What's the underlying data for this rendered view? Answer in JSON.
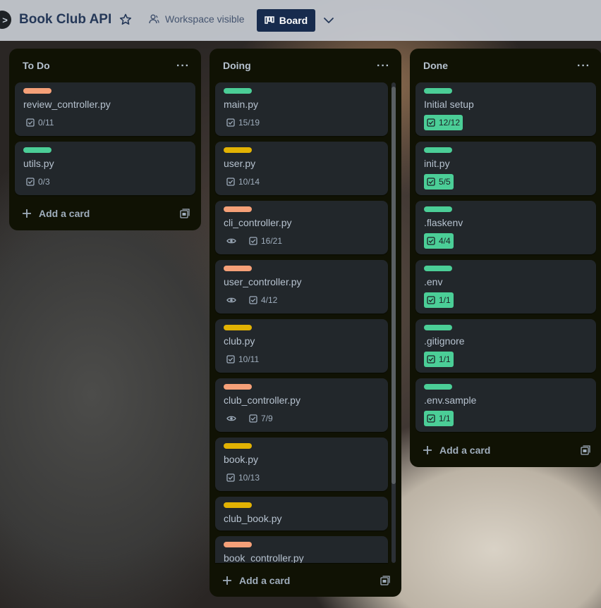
{
  "header": {
    "title": "Book Club API",
    "visibility_label": "Workspace visible",
    "board_button_label": "Board",
    "sidebar_toggle_glyph": ">"
  },
  "colors": {
    "orange": "#f5a078",
    "green": "#4bce97",
    "yellow": "#e2b203",
    "list_bg": "#101204",
    "card_bg": "#22272b"
  },
  "lists": [
    {
      "title": "To Do",
      "add_label": "Add a card",
      "cards": [
        {
          "label_color": "orange",
          "title": "review_controller.py",
          "checklist": "0/11",
          "watched": false,
          "complete": false
        },
        {
          "label_color": "green",
          "title": "utils.py",
          "checklist": "0/3",
          "watched": false,
          "complete": false
        }
      ]
    },
    {
      "title": "Doing",
      "add_label": "Add a card",
      "cards": [
        {
          "label_color": "green",
          "title": "main.py",
          "checklist": "15/19",
          "watched": false,
          "complete": false
        },
        {
          "label_color": "yellow",
          "title": "user.py",
          "checklist": "10/14",
          "watched": false,
          "complete": false
        },
        {
          "label_color": "orange",
          "title": "cli_controller.py",
          "checklist": "16/21",
          "watched": true,
          "complete": false
        },
        {
          "label_color": "orange",
          "title": "user_controller.py",
          "checklist": "4/12",
          "watched": true,
          "complete": false
        },
        {
          "label_color": "yellow",
          "title": "club.py",
          "checklist": "10/11",
          "watched": false,
          "complete": false
        },
        {
          "label_color": "orange",
          "title": "club_controller.py",
          "checklist": "7/9",
          "watched": true,
          "complete": false
        },
        {
          "label_color": "yellow",
          "title": "book.py",
          "checklist": "10/13",
          "watched": false,
          "complete": false
        },
        {
          "label_color": "yellow",
          "title": "club_book.py",
          "checklist": null,
          "watched": false,
          "complete": false
        },
        {
          "label_color": "orange",
          "title": "book_controller.py",
          "checklist": null,
          "watched": false,
          "complete": false
        }
      ]
    },
    {
      "title": "Done",
      "add_label": "Add a card",
      "cards": [
        {
          "label_color": "green",
          "title": "Initial setup",
          "checklist": "12/12",
          "watched": false,
          "complete": true
        },
        {
          "label_color": "green",
          "title": "init.py",
          "checklist": "5/5",
          "watched": false,
          "complete": true
        },
        {
          "label_color": "green",
          "title": ".flaskenv",
          "checklist": "4/4",
          "watched": false,
          "complete": true
        },
        {
          "label_color": "green",
          "title": ".env",
          "checklist": "1/1",
          "watched": false,
          "complete": true
        },
        {
          "label_color": "green",
          "title": ".gitignore",
          "checklist": "1/1",
          "watched": false,
          "complete": true
        },
        {
          "label_color": "green",
          "title": ".env.sample",
          "checklist": "1/1",
          "watched": false,
          "complete": true
        }
      ]
    }
  ]
}
